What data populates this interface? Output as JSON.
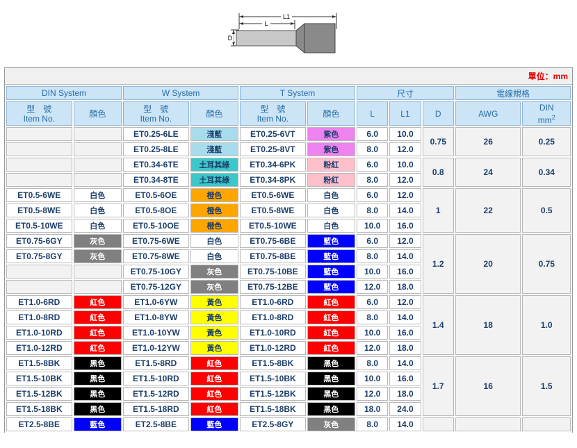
{
  "diagram": {
    "L1": "L1",
    "L": "L",
    "D": "D"
  },
  "unit": "單位：mm",
  "group_headers": [
    "DIN System",
    "W System",
    "T System",
    "尺寸",
    "電線規格"
  ],
  "sub_headers": {
    "model_cn": "型　號",
    "model_en": "Item No.",
    "color": "顏色",
    "L": "L",
    "L1": "L1",
    "D": "D",
    "AWG": "AWG",
    "DIN": "DIN",
    "mm": "mm",
    "mm_sup": "2"
  },
  "colors": {
    "淺藍": "#a8dcec",
    "土耳其綠": "#3cc8c8",
    "紫色": "#ee82ee",
    "粉紅": "#ffc0cb",
    "白色": "#ffffff",
    "橙色": "#ffa500",
    "灰色": "#808080",
    "藍色": "#0000ff",
    "紅色": "#ff0000",
    "黃色": "#ffff00",
    "黑色": "#000000"
  },
  "rows": [
    {
      "din": "",
      "din_color": "",
      "w": "ET0.25-6LE",
      "w_color": "淺藍",
      "t": "ET0.25-6VT",
      "t_color": "紫色",
      "L": "6.0",
      "L1": "10.0"
    },
    {
      "din": "",
      "din_color": "",
      "w": "ET0.25-8LE",
      "w_color": "淺藍",
      "t": "ET0.25-8VT",
      "t_color": "紫色",
      "L": "8.0",
      "L1": "12.0"
    },
    {
      "din": "",
      "din_color": "",
      "w": "ET0.34-6TE",
      "w_color": "土耳其綠",
      "t": "ET0.34-6PK",
      "t_color": "粉紅",
      "L": "6.0",
      "L1": "10.0"
    },
    {
      "din": "",
      "din_color": "",
      "w": "ET0.34-8TE",
      "w_color": "土耳其綠",
      "t": "ET0.34-8PK",
      "t_color": "粉紅",
      "L": "8.0",
      "L1": "12.0"
    },
    {
      "din": "ET0.5-6WE",
      "din_color": "白色",
      "w": "ET0.5-6OE",
      "w_color": "橙色",
      "t": "ET0.5-6WE",
      "t_color": "白色",
      "L": "6.0",
      "L1": "12.0"
    },
    {
      "din": "ET0.5-8WE",
      "din_color": "白色",
      "w": "ET0.5-8OE",
      "w_color": "橙色",
      "t": "ET0.5-8WE",
      "t_color": "白色",
      "L": "8.0",
      "L1": "14.0"
    },
    {
      "din": "ET0.5-10WE",
      "din_color": "白色",
      "w": "ET0.5-10OE",
      "w_color": "橙色",
      "t": "ET0.5-10WE",
      "t_color": "白色",
      "L": "10.0",
      "L1": "16.0"
    },
    {
      "din": "ET0.75-6GY",
      "din_color": "灰色",
      "w": "ET0.75-6WE",
      "w_color": "白色",
      "t": "ET0.75-6BE",
      "t_color": "藍色",
      "L": "6.0",
      "L1": "12.0"
    },
    {
      "din": "ET0.75-8GY",
      "din_color": "灰色",
      "w": "ET0.75-8WE",
      "w_color": "白色",
      "t": "ET0.75-8BE",
      "t_color": "藍色",
      "L": "8.0",
      "L1": "14.0"
    },
    {
      "din": "",
      "din_color": "",
      "w": "ET0.75-10GY",
      "w_color": "灰色",
      "t": "ET0.75-10BE",
      "t_color": "藍色",
      "L": "10.0",
      "L1": "16.0"
    },
    {
      "din": "",
      "din_color": "",
      "w": "ET0.75-12GY",
      "w_color": "灰色",
      "t": "ET0.75-12BE",
      "t_color": "藍色",
      "L": "12.0",
      "L1": "18.0"
    },
    {
      "din": "ET1.0-6RD",
      "din_color": "紅色",
      "w": "ET1.0-6YW",
      "w_color": "黃色",
      "t": "ET1.0-6RD",
      "t_color": "紅色",
      "L": "6.0",
      "L1": "12.0"
    },
    {
      "din": "ET1.0-8RD",
      "din_color": "紅色",
      "w": "ET1.0-8YW",
      "w_color": "黃色",
      "t": "ET1.0-8RD",
      "t_color": "紅色",
      "L": "8.0",
      "L1": "14.0"
    },
    {
      "din": "ET1.0-10RD",
      "din_color": "紅色",
      "w": "ET1.0-10YW",
      "w_color": "黃色",
      "t": "ET1.0-10RD",
      "t_color": "紅色",
      "L": "10.0",
      "L1": "16.0"
    },
    {
      "din": "ET1.0-12RD",
      "din_color": "紅色",
      "w": "ET1.0-12YW",
      "w_color": "黃色",
      "t": "ET1.0-12RD",
      "t_color": "紅色",
      "L": "12.0",
      "L1": "18.0"
    },
    {
      "din": "ET1.5-8BK",
      "din_color": "黑色",
      "w": "ET1.5-8RD",
      "w_color": "紅色",
      "t": "ET1.5-8BK",
      "t_color": "黑色",
      "L": "8.0",
      "L1": "14.0"
    },
    {
      "din": "ET1.5-10BK",
      "din_color": "黑色",
      "w": "ET1.5-10RD",
      "w_color": "紅色",
      "t": "ET1.5-10BK",
      "t_color": "黑色",
      "L": "10.0",
      "L1": "16.0"
    },
    {
      "din": "ET1.5-12BK",
      "din_color": "黑色",
      "w": "ET1.5-12RD",
      "w_color": "紅色",
      "t": "ET1.5-12BK",
      "t_color": "黑色",
      "L": "12.0",
      "L1": "18.0"
    },
    {
      "din": "ET1.5-18BK",
      "din_color": "黑色",
      "w": "ET1.5-18RD",
      "w_color": "紅色",
      "t": "ET1.5-18BK",
      "t_color": "黑色",
      "L": "18.0",
      "L1": "24.0"
    },
    {
      "din": "ET2.5-8BE",
      "din_color": "藍色",
      "w": "ET2.5-8BE",
      "w_color": "藍色",
      "t": "ET2.5-8GY",
      "t_color": "灰色",
      "L": "8.0",
      "L1": "14.0"
    }
  ],
  "groups": [
    {
      "start": 0,
      "span": 2,
      "D": "0.75",
      "AWG": "26",
      "DIN": "0.25"
    },
    {
      "start": 2,
      "span": 2,
      "D": "0.8",
      "AWG": "24",
      "DIN": "0.34"
    },
    {
      "start": 4,
      "span": 3,
      "D": "1",
      "AWG": "22",
      "DIN": "0.5"
    },
    {
      "start": 7,
      "span": 4,
      "D": "1.2",
      "AWG": "20",
      "DIN": "0.75"
    },
    {
      "start": 11,
      "span": 4,
      "D": "1.4",
      "AWG": "18",
      "DIN": "1.0"
    },
    {
      "start": 15,
      "span": 4,
      "D": "1.7",
      "AWG": "16",
      "DIN": "1.5"
    },
    {
      "start": 19,
      "span": 1,
      "D": "",
      "AWG": "",
      "DIN": ""
    }
  ]
}
